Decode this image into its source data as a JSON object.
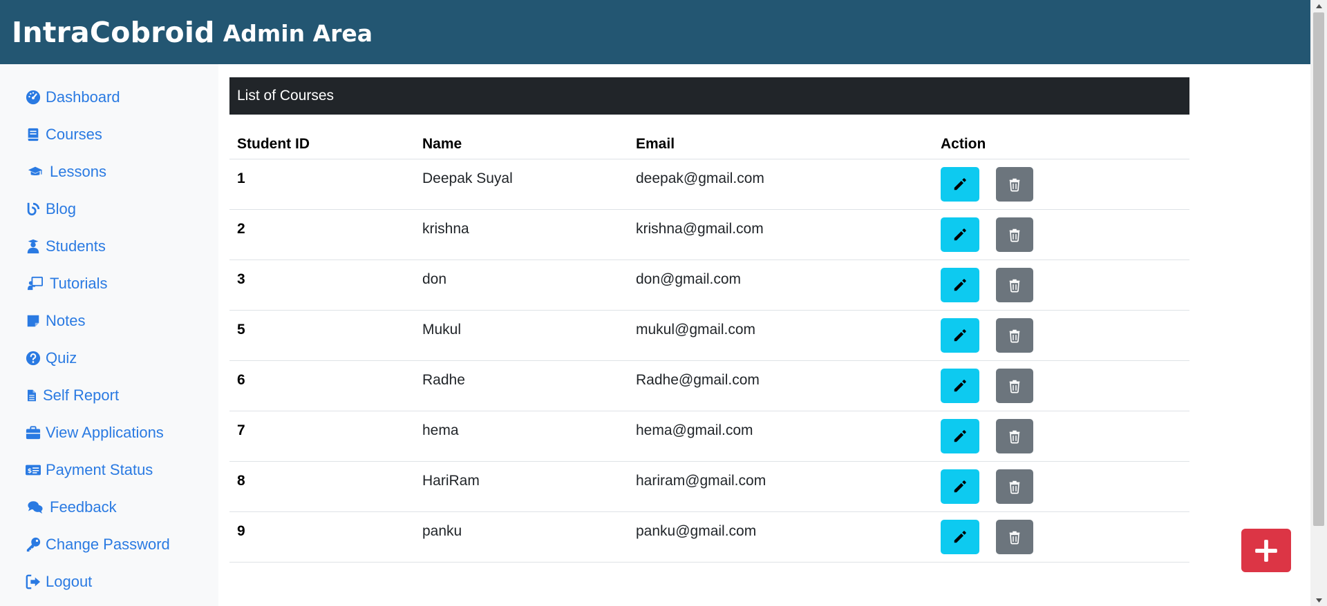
{
  "header": {
    "brand": "IntraCobroid",
    "subtitle": "Admin Area"
  },
  "sidebar": {
    "items": [
      {
        "label": "Dashboard",
        "icon": "dashboard-icon"
      },
      {
        "label": "Courses",
        "icon": "book-icon"
      },
      {
        "label": "Lessons",
        "icon": "graduation-cap-icon"
      },
      {
        "label": "Blog",
        "icon": "blog-icon"
      },
      {
        "label": "Students",
        "icon": "student-icon"
      },
      {
        "label": "Tutorials",
        "icon": "chalkboard-teacher-icon"
      },
      {
        "label": "Notes",
        "icon": "sticky-note-icon"
      },
      {
        "label": "Quiz",
        "icon": "question-circle-icon"
      },
      {
        "label": "Self Report",
        "icon": "file-icon"
      },
      {
        "label": "View Applications",
        "icon": "briefcase-icon"
      },
      {
        "label": "Payment Status",
        "icon": "money-check-icon"
      },
      {
        "label": "Feedback",
        "icon": "comments-icon"
      },
      {
        "label": "Change Password",
        "icon": "key-icon"
      },
      {
        "label": "Logout",
        "icon": "sign-out-icon"
      }
    ]
  },
  "main": {
    "card_title": "List of Courses",
    "columns": [
      "Student ID",
      "Name",
      "Email",
      "Action"
    ],
    "rows": [
      {
        "id": "1",
        "name": "Deepak Suyal",
        "email": "deepak@gmail.com"
      },
      {
        "id": "2",
        "name": "krishna",
        "email": "krishna@gmail.com"
      },
      {
        "id": "3",
        "name": "don",
        "email": "don@gmail.com"
      },
      {
        "id": "5",
        "name": "Mukul",
        "email": "mukul@gmail.com"
      },
      {
        "id": "6",
        "name": "Radhe",
        "email": "Radhe@gmail.com"
      },
      {
        "id": "7",
        "name": "hema",
        "email": "hema@gmail.com"
      },
      {
        "id": "8",
        "name": "HariRam",
        "email": "hariram@gmail.com"
      },
      {
        "id": "9",
        "name": "panku",
        "email": "panku@gmail.com"
      }
    ]
  },
  "actions": {
    "edit_icon": "pencil-icon",
    "delete_icon": "trash-icon",
    "add_icon": "plus-icon"
  },
  "colors": {
    "header_bg": "#235672",
    "card_header_bg": "#212529",
    "link": "#2a7ae2",
    "edit_button": "#0dcaf0",
    "delete_button": "#6c757d",
    "add_button": "#dc3545"
  }
}
